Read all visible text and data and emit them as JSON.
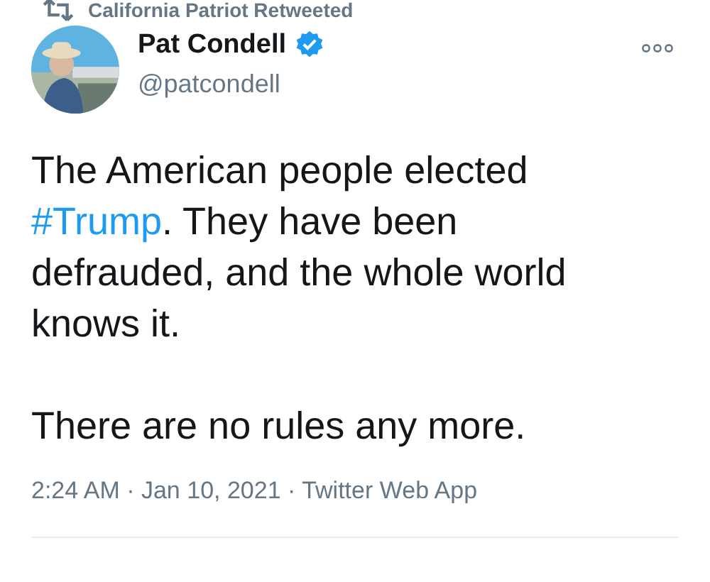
{
  "social_context": {
    "text": "California Patriot Retweeted"
  },
  "author": {
    "name": "Pat Condell",
    "verified": true,
    "handle": "@patcondell"
  },
  "tweet": {
    "paragraphs": [
      {
        "parts": [
          {
            "kind": "text",
            "text": "The American people elected "
          },
          {
            "kind": "hashtag",
            "text": "#Trump"
          },
          {
            "kind": "text",
            "text": ". They have been defrauded, and the whole world knows it."
          }
        ]
      },
      {
        "parts": [
          {
            "kind": "text",
            "text": "There are no rules any more."
          }
        ]
      }
    ]
  },
  "meta": "2:24 AM · Jan 10, 2021 · Twitter Web App"
}
